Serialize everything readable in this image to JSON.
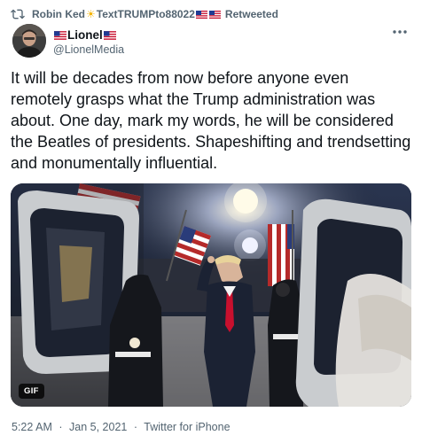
{
  "retweet": {
    "icon": "retweet-icon",
    "name_part1": "Robin Ked",
    "name_part2": "TextTRUMPto88022",
    "retweeted_label": "Retweeted"
  },
  "author": {
    "display_name": "Lionel",
    "handle": "@LionelMedia",
    "avatar": "avatar-photo"
  },
  "tweet": {
    "text": "It will be decades from now before anyone even remotely grasps what the Trump administration was about. One day, mark my words, he will be considered the Beatles of presidents. Shapeshifting and trendsetting and monumentally influential."
  },
  "media": {
    "badge": "GIF"
  },
  "meta": {
    "time": "5:22 AM",
    "date": "Jan 5, 2021",
    "source": "Twitter for iPhone",
    "separator": "·"
  },
  "colors": {
    "text": "#0f1419",
    "secondary": "#536471",
    "media_bg": "#1a1f2a"
  }
}
